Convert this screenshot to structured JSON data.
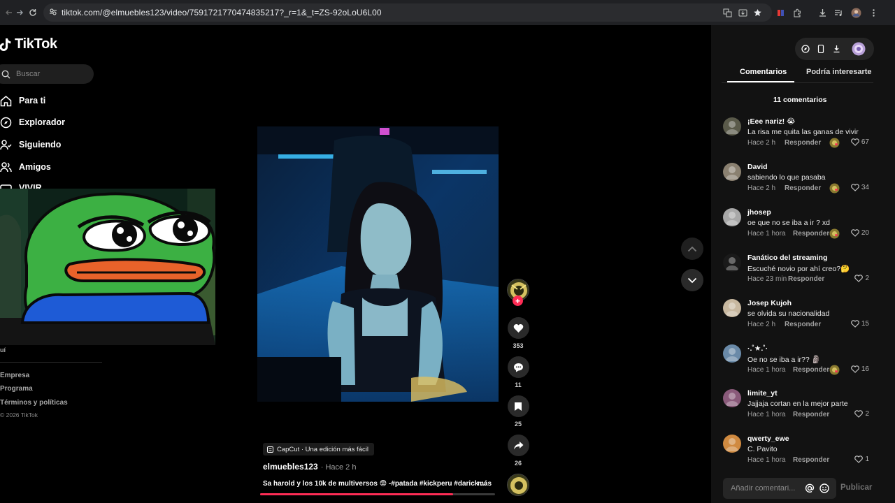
{
  "browser": {
    "url": "tiktok.com/@elmuebles123/video/7591721770474835217?_r=1&_t=ZS-92oLoU6L00"
  },
  "sidebar": {
    "logo": "TikTok",
    "search_placeholder": "Buscar",
    "nav": [
      {
        "label": "Para ti",
        "icon": "home-icon"
      },
      {
        "label": "Explorador",
        "icon": "compass-icon"
      },
      {
        "label": "Siguiendo",
        "icon": "following-icon"
      },
      {
        "label": "Amigos",
        "icon": "friends-icon"
      },
      {
        "label": "VIVIR",
        "icon": "live-icon"
      }
    ],
    "partial_text": "uí",
    "footer": [
      "Empresa",
      "Programa",
      "Términos y políticas"
    ],
    "copyright": "© 2026 TikTok"
  },
  "video": {
    "badge": "CapCut · Una edición más fácil",
    "author": "elmuebles123",
    "posted": "· Hace 2 h",
    "caption": "Sa harold y los 10k de multiversos 😨 -#patada #kickperu #darick ...",
    "more": "más",
    "progress": 0.82
  },
  "actions": {
    "likes": "353",
    "comments": "11",
    "saves": "25",
    "shares": "26"
  },
  "panel": {
    "tabs": [
      "Comentarios",
      "Podría interesarte"
    ],
    "active_tab": "Comentarios",
    "comment_count_label": "11 comentarios",
    "reply_label": "Responder",
    "add_placeholder": "Añadir comentari...",
    "publish_label": "Publicar",
    "comments": [
      {
        "user": "¡Eee nariz! 😭",
        "text": "La risa me quita las ganas de vivir",
        "time": "Hace 2 h",
        "likes": "67",
        "creator_liked": true,
        "avatar_color": "#5a5a4a"
      },
      {
        "user": "David",
        "text": "sabiendo lo que pasaba",
        "time": "Hace 2 h",
        "likes": "34",
        "creator_liked": true,
        "avatar_color": "#8a8070"
      },
      {
        "user": "jhosep",
        "text": "oe que no se iba a ir ? xd",
        "time": "Hace 1 hora",
        "likes": "20",
        "creator_liked": true,
        "avatar_color": "#a8a8a8"
      },
      {
        "user": "Fanático del streaming",
        "text": "Escuché novio por ahí creo?🤔",
        "time": "Hace 23 min",
        "likes": "2",
        "creator_liked": false,
        "avatar_color": "#1a1a1a"
      },
      {
        "user": "Josep Kujoh",
        "text": "se olvida su nacionalidad",
        "time": "Hace 2 h",
        "likes": "15",
        "creator_liked": false,
        "avatar_color": "#c8b8a0"
      },
      {
        "user": "·.˚★.˚·",
        "text": "Oe no se iba a ir?? 🗿",
        "time": "Hace 1 hora",
        "likes": "16",
        "creator_liked": true,
        "avatar_color": "#6a8aa8"
      },
      {
        "user": "limite_yt",
        "text": "Jajjaja cortan en la mejor parte",
        "time": "Hace 1 hora",
        "likes": "2",
        "creator_liked": false,
        "avatar_color": "#8a5a7a"
      },
      {
        "user": "qwerty_ewe",
        "text": "C. Pavito",
        "time": "Hace 1 hora",
        "likes": "1",
        "creator_liked": false,
        "avatar_color": "#d08a40"
      }
    ]
  }
}
